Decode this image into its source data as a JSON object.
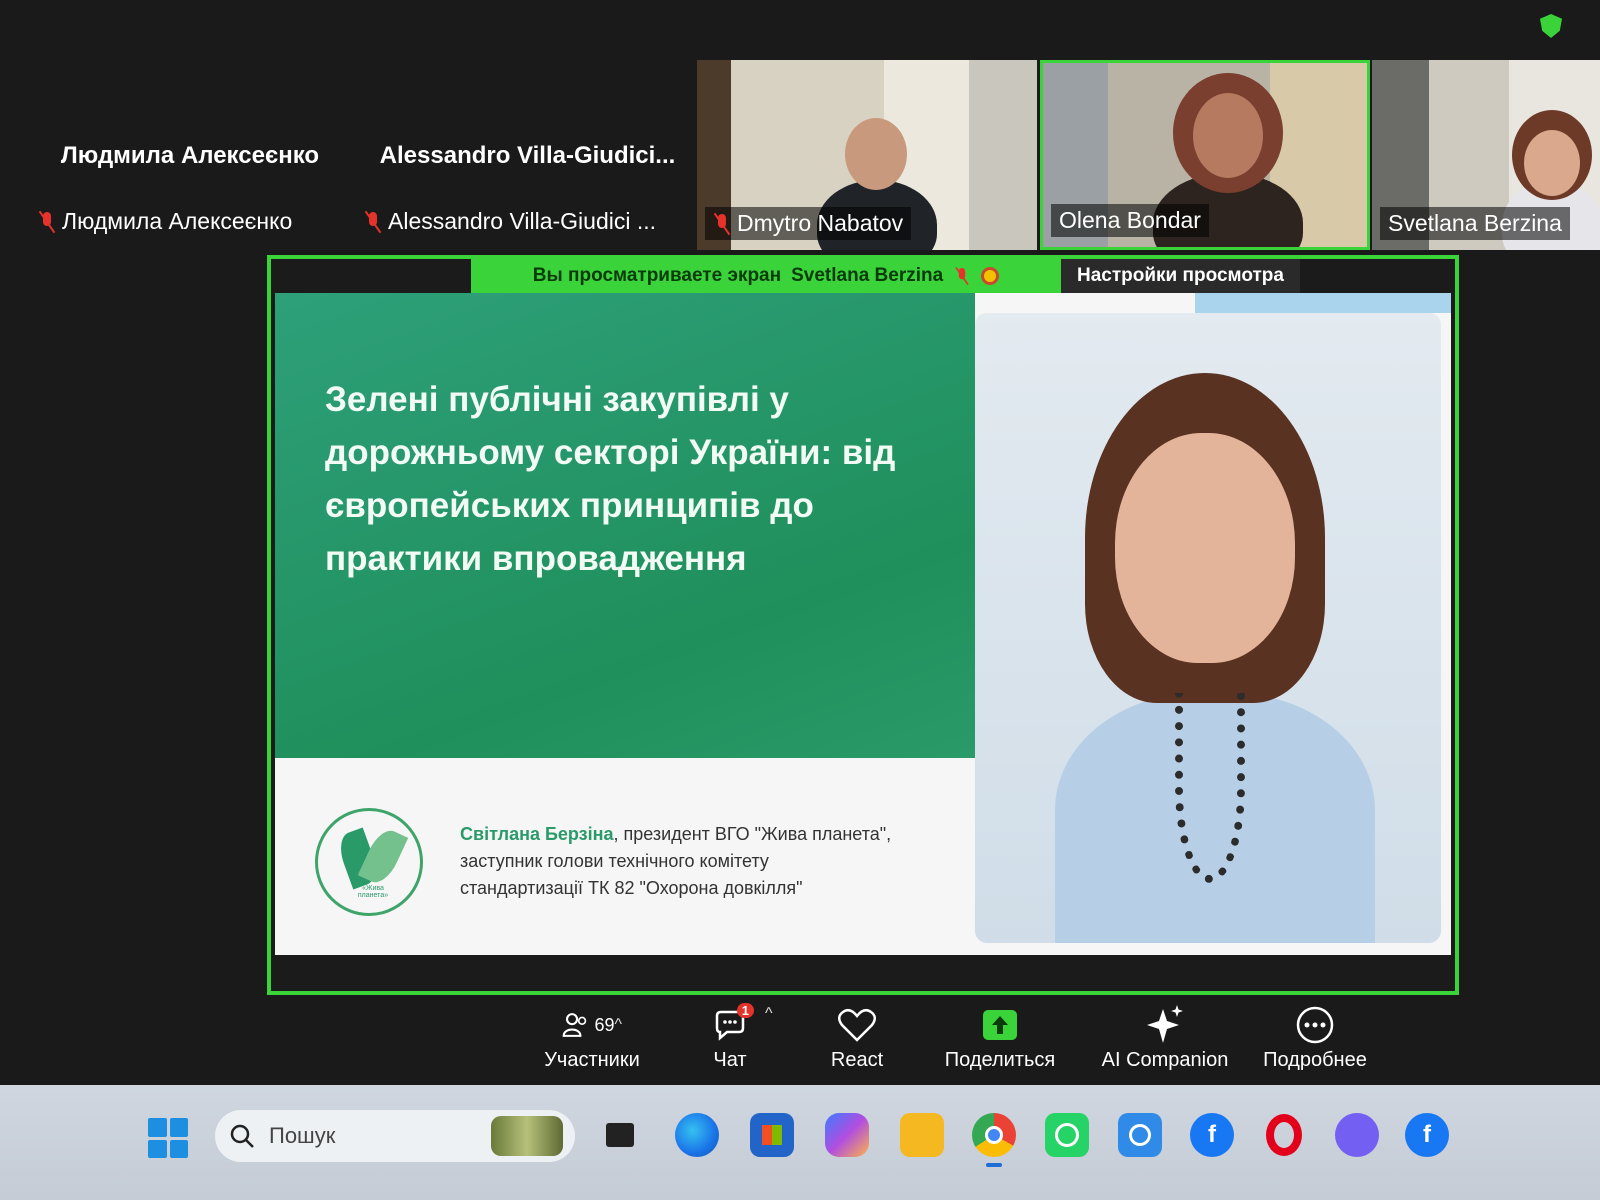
{
  "gallery": {
    "tiles": [
      {
        "big_name": "Людмила Алексеєнко",
        "small_name": "Людмила Алексеєнко"
      },
      {
        "big_name": "Alessandro Villa-Giudici...",
        "small_name": "Alessandro Villa-Giudici ..."
      }
    ],
    "videos": [
      {
        "name": "Dmytro Nabatov"
      },
      {
        "name": "Olena Bondar"
      },
      {
        "name": "Svetlana Berzina"
      }
    ]
  },
  "share": {
    "banner": "Вы просматриваете экран",
    "presenter": "Svetlana Berzina",
    "view_settings": "Настройки просмотра"
  },
  "slide": {
    "title": "Зелені публічні закупівлі у дорожньому секторі України: від європейських принципів до практики впровадження",
    "author_name": "Світлана Берзіна",
    "author_line1": ", президент ВГО \"Жива планета\",",
    "author_line2": "заступник голови технічного комітету",
    "author_line3": "стандартизації ТК 82 \"Охорона довкілля\"",
    "logo_text": "«Жива планета»"
  },
  "toolbar": {
    "participants_label": "Участники",
    "participants_count": "69",
    "chat_label": "Чат",
    "chat_badge": "1",
    "react_label": "React",
    "share_label": "Поделиться",
    "ai_label": "AI Companion",
    "more_label": "Подробнее"
  },
  "taskbar": {
    "search_placeholder": "Пошук"
  },
  "colors": {
    "active_green": "#3ad33a",
    "slide_green": "#1f8f5b",
    "muted_red": "#e5322b"
  }
}
